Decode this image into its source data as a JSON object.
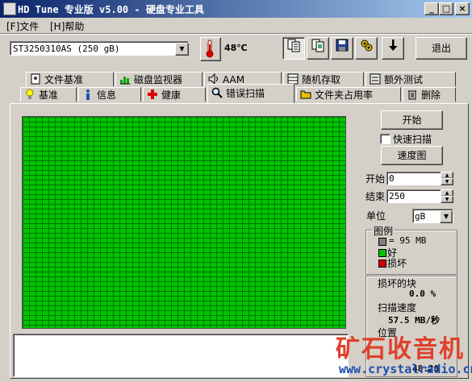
{
  "window": {
    "title": "HD Tune 专业版 v5.00 - 硬盘专业工具",
    "controls": [
      "_",
      "□",
      "×"
    ]
  },
  "menu": [
    {
      "label": "[F]文件"
    },
    {
      "label": "[H]帮助"
    }
  ],
  "toolbar": {
    "drive": "ST3250310AS (250 gB)",
    "temperature": "48℃",
    "exit_label": "退出",
    "icons": [
      "copy-info-icon",
      "copy-screen-icon",
      "save-icon",
      "options-icon",
      "download-icon"
    ]
  },
  "tabs_back": [
    {
      "label": "文件基准",
      "icon": "file-benchmark-icon"
    },
    {
      "label": "磁盘监视器",
      "icon": "disk-monitor-icon"
    },
    {
      "label": "AAM",
      "icon": "speaker-icon"
    },
    {
      "label": "随机存取",
      "icon": "random-access-icon"
    },
    {
      "label": "额外测试",
      "icon": "extra-tests-icon"
    }
  ],
  "tabs_front": [
    {
      "label": "基准",
      "icon": "benchmark-icon"
    },
    {
      "label": "信息",
      "icon": "info-icon"
    },
    {
      "label": "健康",
      "icon": "health-icon"
    },
    {
      "label": "错误扫描",
      "icon": "search-icon",
      "active": true
    },
    {
      "label": "文件夹占用率",
      "icon": "folder-icon"
    },
    {
      "label": "删除",
      "icon": "trash-icon"
    }
  ],
  "scan": {
    "grid_color": "#00c400",
    "start_button": "开始",
    "quick_scan_label": "快速扫描",
    "quick_scan_checked": false,
    "speed_map_button": "速度图",
    "start_label": "开始",
    "start_value": "0",
    "end_label": "结束",
    "end_value": "250",
    "unit_label": "单位",
    "unit_value": "gB"
  },
  "legend": {
    "title": "图例",
    "block_size": "= 95 MB",
    "good": "好",
    "bad": "损坏",
    "colors": {
      "block": "#808080",
      "good": "#00c400",
      "bad": "#d00000"
    }
  },
  "stats": {
    "damaged_label": "损坏的块",
    "damaged_value": "0.0 %",
    "speed_label": "扫描速度",
    "speed_value": "57.5 MB/秒",
    "position_label": "位置",
    "elapsed_value": "48:20"
  },
  "watermark": {
    "cn": "矿石收音机",
    "url": "www.crystalradio.cn"
  }
}
